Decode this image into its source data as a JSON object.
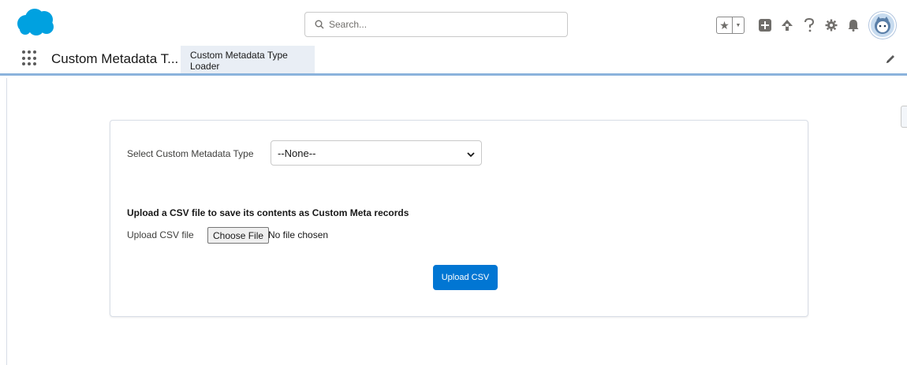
{
  "header": {
    "logo_icon": "salesforce-cloud-logo",
    "search": {
      "placeholder": "Search..."
    },
    "icons": [
      "favorites-star-icon",
      "favorites-dropdown-icon",
      "global-actions-plus-icon",
      "trailhead-icon",
      "help-icon",
      "setup-gear-icon",
      "notifications-bell-icon",
      "user-avatar"
    ]
  },
  "nav": {
    "app_name": "Custom Metadata T...",
    "tabs": [
      {
        "label": "Custom Metadata Type Loader"
      }
    ],
    "edit_icon": "pencil-icon"
  },
  "form": {
    "select_label": "Select Custom Metadata Type",
    "select_value": "--None--",
    "section_title": "Upload a CSV file to save its contents as Custom Meta records",
    "upload_label": "Upload CSV file",
    "choose_file_label": "Choose File",
    "file_status": "No file chosen",
    "submit_label": "Upload CSV"
  },
  "colors": {
    "brand_blue": "#0176d3",
    "logo_blue": "#00a1e0",
    "nav_underline": "#8bb3dc",
    "tab_bg": "#e9eef5"
  }
}
